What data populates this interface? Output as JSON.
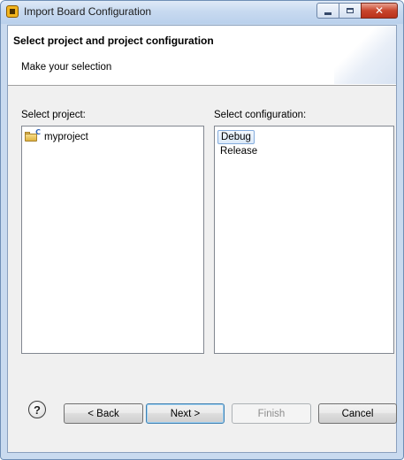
{
  "window": {
    "title": "Import Board Configuration",
    "controls": {
      "minimize_icon": "minimize-icon",
      "maximize_icon": "maximize-icon",
      "close_glyph": "✕"
    }
  },
  "header": {
    "title": "Select project and project configuration",
    "subtitle": "Make your selection"
  },
  "project_list": {
    "label": "Select project:",
    "items": [
      {
        "label": "myproject",
        "icon": "c-project-folder-icon"
      }
    ]
  },
  "config_list": {
    "label": "Select configuration:",
    "items": [
      {
        "label": "Debug",
        "selected": true
      },
      {
        "label": "Release",
        "selected": false
      }
    ]
  },
  "footer": {
    "help_glyph": "?",
    "back_label": "< Back",
    "next_label": "Next >",
    "finish_label": "Finish",
    "cancel_label": "Cancel"
  },
  "colors": {
    "title_bar": "#c8daf0",
    "dialog_bg": "#f0f0f0",
    "selection_border": "#84acdd",
    "default_button_border": "#3c7fb1",
    "close_button": "#c8452c"
  }
}
